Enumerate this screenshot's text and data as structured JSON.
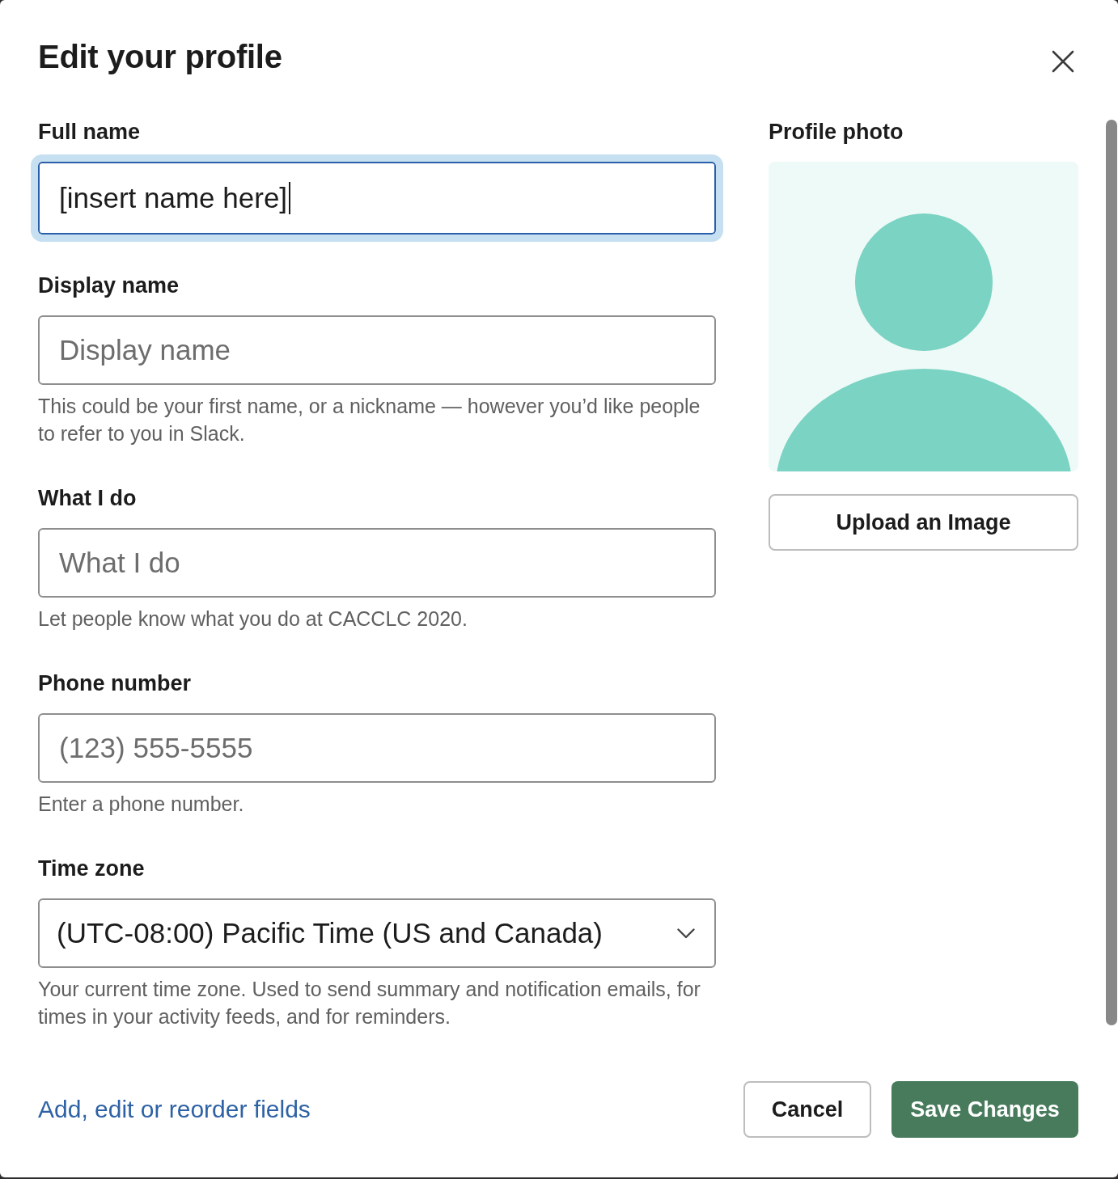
{
  "dialog": {
    "title": "Edit your profile"
  },
  "fields": [
    {
      "kind": "text",
      "label": "Full name",
      "value": "[insert name here]",
      "focused": true
    },
    {
      "kind": "text",
      "label": "Display name",
      "placeholder": "Display name",
      "focused": false,
      "help": "This could be your first name, or a nickname — however you’d like people to refer to you in Slack."
    },
    {
      "kind": "text",
      "label": "What I do",
      "placeholder": "What I do",
      "focused": false,
      "help": "Let people know what you do at CACCLC 2020."
    },
    {
      "kind": "text",
      "label": "Phone number",
      "placeholder": "(123) 555-5555",
      "focused": false,
      "help": "Enter a phone number."
    },
    {
      "kind": "select",
      "label": "Time zone",
      "value": "(UTC-08:00) Pacific Time (US and Canada)",
      "focused": false,
      "help": "Your current time zone. Used to send summary and notification emails, for times in your activity feeds, and for reminders."
    }
  ],
  "profile_photo": {
    "label": "Profile photo",
    "upload_button": "Upload an Image"
  },
  "footer": {
    "link": "Add, edit or reorder fields",
    "buttons": [
      {
        "kind": "secondary",
        "label": "Cancel"
      },
      {
        "kind": "primary",
        "label": "Save Changes"
      }
    ]
  }
}
